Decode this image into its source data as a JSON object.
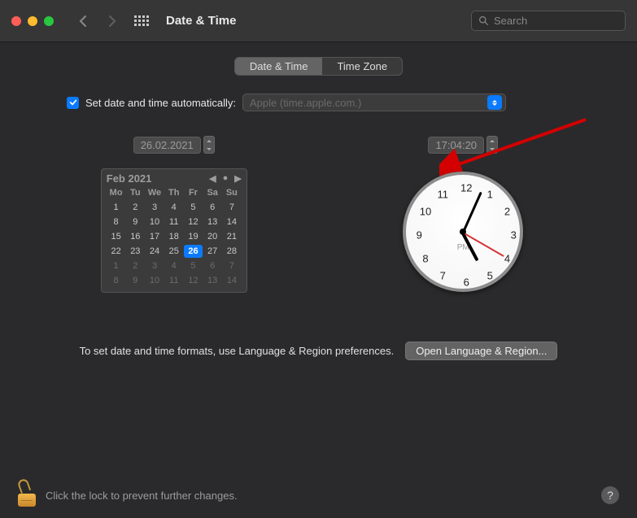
{
  "window": {
    "title": "Date & Time"
  },
  "search": {
    "placeholder": "Search"
  },
  "tabs": {
    "dateTime": "Date & Time",
    "timeZone": "Time Zone"
  },
  "auto": {
    "checked": true,
    "label": "Set date and time automatically:",
    "server": "Apple (time.apple.com.)"
  },
  "dateField": "26.02.2021",
  "timeField": "17:04:20",
  "calendar": {
    "month": "Feb 2021",
    "dow": [
      "Mo",
      "Tu",
      "We",
      "Th",
      "Fr",
      "Sa",
      "Su"
    ],
    "weeks": [
      [
        {
          "n": 1
        },
        {
          "n": 2
        },
        {
          "n": 3
        },
        {
          "n": 4
        },
        {
          "n": 5
        },
        {
          "n": 6
        },
        {
          "n": 7
        }
      ],
      [
        {
          "n": 8
        },
        {
          "n": 9
        },
        {
          "n": 10
        },
        {
          "n": 11
        },
        {
          "n": 12
        },
        {
          "n": 13
        },
        {
          "n": 14
        }
      ],
      [
        {
          "n": 15
        },
        {
          "n": 16
        },
        {
          "n": 17
        },
        {
          "n": 18
        },
        {
          "n": 19
        },
        {
          "n": 20
        },
        {
          "n": 21
        }
      ],
      [
        {
          "n": 22
        },
        {
          "n": 23
        },
        {
          "n": 24
        },
        {
          "n": 25
        },
        {
          "n": 26,
          "sel": true
        },
        {
          "n": 27
        },
        {
          "n": 28
        }
      ],
      [
        {
          "n": 1,
          "o": true
        },
        {
          "n": 2,
          "o": true
        },
        {
          "n": 3,
          "o": true
        },
        {
          "n": 4,
          "o": true
        },
        {
          "n": 5,
          "o": true
        },
        {
          "n": 6,
          "o": true
        },
        {
          "n": 7,
          "o": true
        }
      ],
      [
        {
          "n": 8,
          "o": true
        },
        {
          "n": 9,
          "o": true
        },
        {
          "n": 10,
          "o": true
        },
        {
          "n": 11,
          "o": true
        },
        {
          "n": 12,
          "o": true
        },
        {
          "n": 13,
          "o": true
        },
        {
          "n": 14,
          "o": true
        }
      ]
    ]
  },
  "clock": {
    "ampm": "PM",
    "hour": 5,
    "minute": 4,
    "second": 20
  },
  "formatHint": "To set date and time formats, use Language & Region preferences.",
  "openLangRegion": "Open Language & Region...",
  "lockMessage": "Click the lock to prevent further changes."
}
